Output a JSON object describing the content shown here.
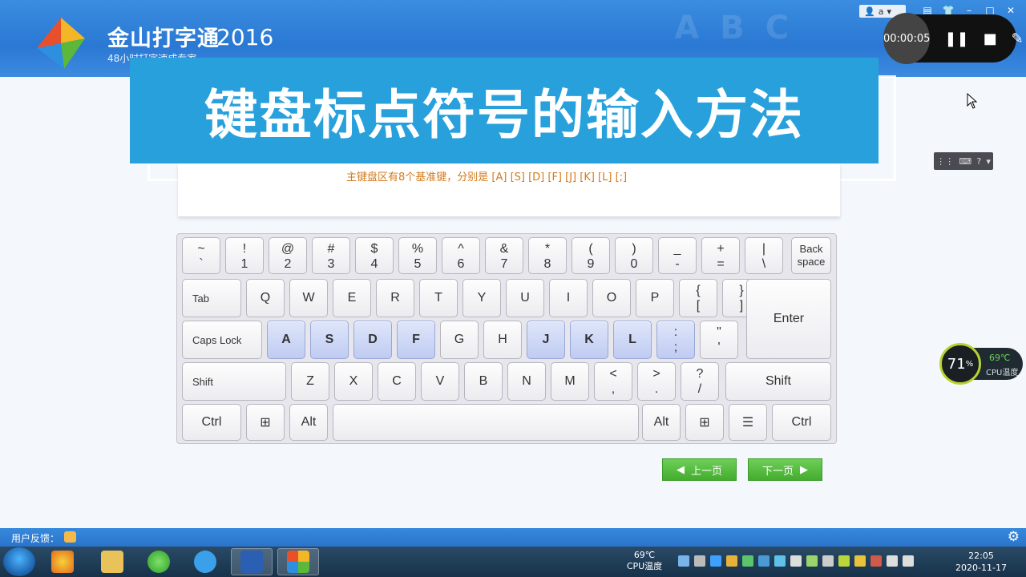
{
  "app": {
    "name": "金山打字通",
    "year": "2016",
    "subtitle": "48小时打字速成专家",
    "deco_letters": "A B C"
  },
  "window": {
    "user_label": "a",
    "minimize": "–",
    "maximize": "□",
    "close": "✕"
  },
  "recorder": {
    "time": "00:00:05",
    "pause": "❚❚",
    "stop": "■",
    "edit": "✎"
  },
  "lesson": {
    "title": "键盘标点符号的输入方法",
    "hint": "主键盘区有8个基准键，分别是 [A] [S] [D] [F] [J] [K] [L] [;]"
  },
  "keyboard": {
    "row1": [
      {
        "top": "~",
        "bot": "`"
      },
      {
        "top": "!",
        "bot": "1"
      },
      {
        "top": "@",
        "bot": "2"
      },
      {
        "top": "#",
        "bot": "3"
      },
      {
        "top": "$",
        "bot": "4"
      },
      {
        "top": "%",
        "bot": "5"
      },
      {
        "top": "^",
        "bot": "6"
      },
      {
        "top": "&",
        "bot": "7"
      },
      {
        "top": "*",
        "bot": "8"
      },
      {
        "top": "(",
        "bot": "9"
      },
      {
        "top": ")",
        "bot": "0"
      },
      {
        "top": "_",
        "bot": "-"
      },
      {
        "top": "+",
        "bot": "="
      },
      {
        "top": "|",
        "bot": "\\"
      }
    ],
    "backspace": "Back space",
    "tab": "Tab",
    "row2": [
      "Q",
      "W",
      "E",
      "R",
      "T",
      "Y",
      "U",
      "I",
      "O",
      "P"
    ],
    "row2_brackets": [
      {
        "top": "{",
        "bot": "["
      },
      {
        "top": "}",
        "bot": "]"
      }
    ],
    "caps": "Caps Lock",
    "row3": [
      "A",
      "S",
      "D",
      "F",
      "G",
      "H",
      "J",
      "K",
      "L"
    ],
    "row3_semicolon": {
      "top": ":",
      "bot": ";"
    },
    "row3_quote": {
      "top": "\"",
      "bot": "'"
    },
    "home_keys": [
      "A",
      "S",
      "D",
      "F",
      "J",
      "K",
      "L",
      ";"
    ],
    "enter": "Enter",
    "shift": "Shift",
    "row4": [
      "Z",
      "X",
      "C",
      "V",
      "B",
      "N",
      "M"
    ],
    "row4_punct": [
      {
        "top": "<",
        "bot": ","
      },
      {
        "top": ">",
        "bot": "."
      },
      {
        "top": "?",
        "bot": "/"
      }
    ],
    "ctrl": "Ctrl",
    "alt": "Alt"
  },
  "nav": {
    "prev": "上一页",
    "next": "下一页"
  },
  "cpu_widget": {
    "usage": "71",
    "usage_unit": "%",
    "temp": "69℃",
    "label": "CPU温度"
  },
  "statusbar": {
    "feedback": "用户反馈："
  },
  "taskbar": {
    "cpu_temp": "69℃",
    "cpu_label": "CPU温度",
    "time": "22:05",
    "date": "2020-11-17"
  }
}
